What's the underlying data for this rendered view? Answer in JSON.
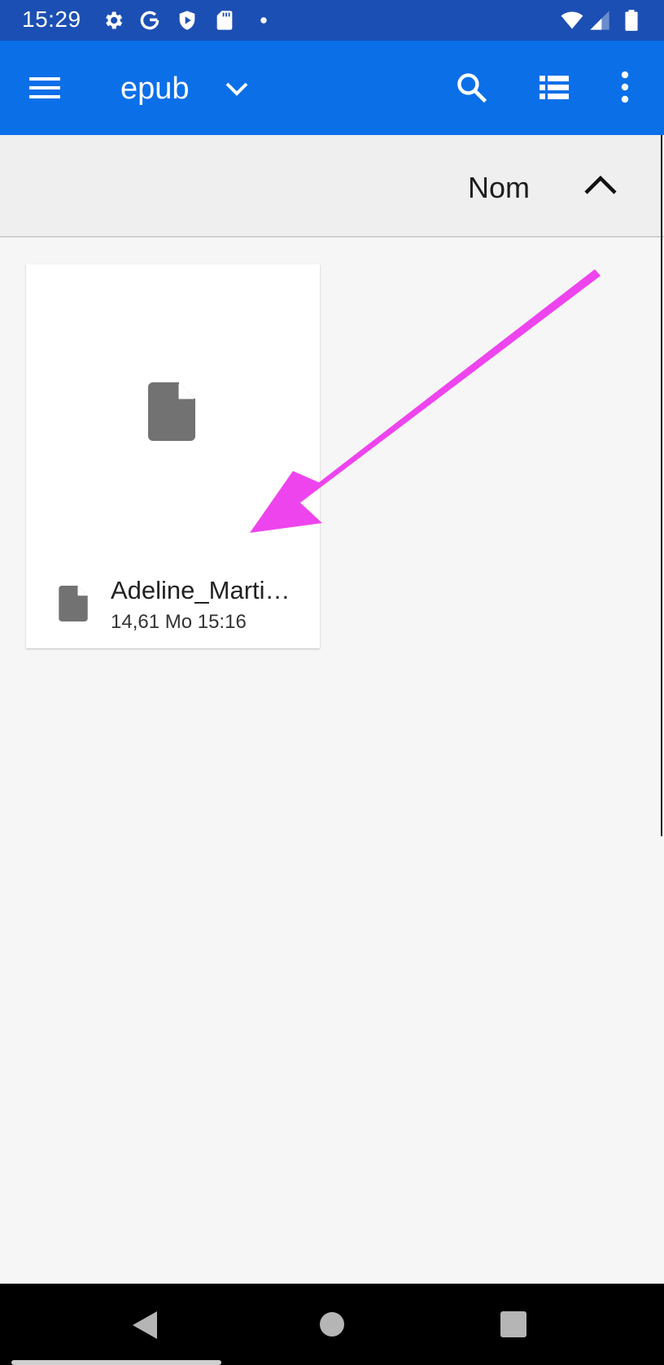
{
  "status_bar": {
    "time": "15:29",
    "icons_left": [
      "settings-icon",
      "google-icon",
      "shield-icon",
      "sd-card-icon",
      "dot-icon"
    ],
    "icons_right": [
      "wifi-icon",
      "signal-icon",
      "battery-icon"
    ]
  },
  "app_bar": {
    "title": "epub",
    "icons": [
      "menu-icon",
      "chevron-down-icon",
      "search-icon",
      "list-view-icon",
      "more-vert-icon"
    ],
    "color": "#0b6fe8"
  },
  "sort_header": {
    "label": "Nom",
    "direction_icon": "chevron-up-icon"
  },
  "files": [
    {
      "name": "Adeline_Marti…",
      "meta": "14,61 Mo 15:16",
      "icon": "file-icon"
    }
  ],
  "annotation": {
    "type": "arrow",
    "color": "#ee44ee"
  },
  "nav_bar": {
    "icons": [
      "back-icon",
      "home-icon",
      "recents-icon"
    ]
  }
}
